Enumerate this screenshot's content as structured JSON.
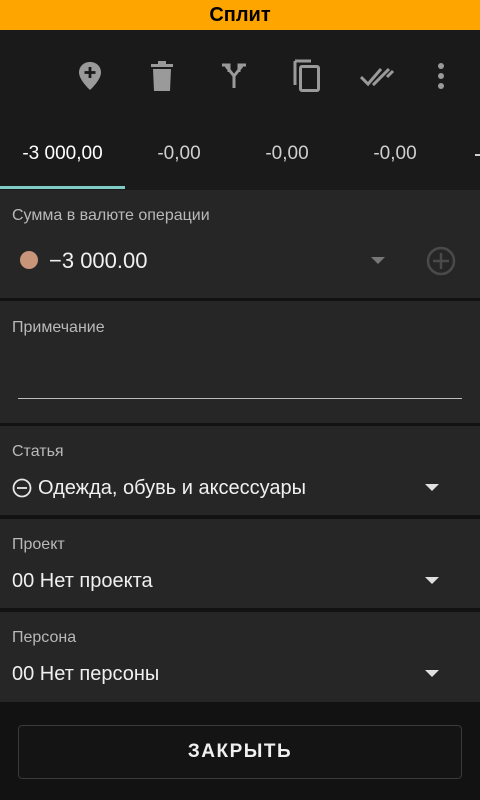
{
  "title": "Сплит",
  "toolbar": {
    "icons": [
      "add-location-icon",
      "delete-icon",
      "split-icon",
      "copy-icon",
      "done-all-icon",
      "more-vert-icon"
    ]
  },
  "tabs": [
    {
      "label": "-3 000,00",
      "active": true
    },
    {
      "label": "-0,00",
      "active": false
    },
    {
      "label": "-0,00",
      "active": false
    },
    {
      "label": "-0,00",
      "active": false
    }
  ],
  "amount_section": {
    "label": "Сумма в валюте операции",
    "value": "−3 000.00",
    "currency_dot_color": "#C8957A"
  },
  "note_section": {
    "label": "Примечание",
    "value": ""
  },
  "category_section": {
    "label": "Статья",
    "value": "Одежда, обувь и аксессуары"
  },
  "project_section": {
    "label": "Проект",
    "value": "00 Нет проекта"
  },
  "person_section": {
    "label": "Персона",
    "value": "00 Нет персоны"
  },
  "close_button": {
    "label": "ЗАКРЫТЬ"
  },
  "colors": {
    "title_bar": "#FFA500",
    "tab_indicator": "#80CBC4",
    "card": "#262626",
    "background": "#121212"
  }
}
